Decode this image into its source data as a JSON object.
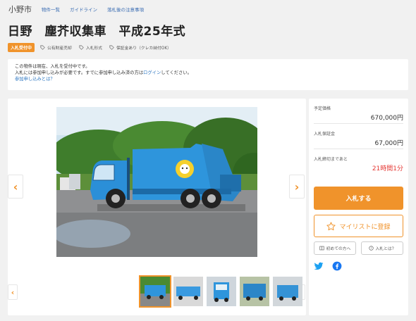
{
  "nav": {
    "brand": "小野市",
    "links": [
      "物件一覧",
      "ガイドライン",
      "落札後の注意事項"
    ]
  },
  "listing": {
    "title": "日野　塵芥収集車　平成25年式",
    "status_badge": "入札受付中",
    "tags": [
      {
        "icon": "tag-icon",
        "label": "公有財産売却"
      },
      {
        "icon": "tag-icon",
        "label": "入札形式"
      },
      {
        "icon": "tag-icon",
        "label": "保証金あり（クレカ納付OK）"
      }
    ]
  },
  "notice": {
    "line1": "この物件は現在、入札を受付中です。",
    "line2_before": "入札には参加申し込みが必要です。すでに参加申し込み済の方は",
    "line2_link": "ログイン",
    "line2_after": "してください。",
    "help_link": "参加申し込みとは？"
  },
  "gallery": {
    "prev_icon": "chevron-left-icon",
    "next_icon": "chevron-right-icon",
    "thumb_count": 5,
    "active_thumb": 0
  },
  "sidebar": {
    "expected_price_label": "予定価格",
    "expected_price_value": "670,000円",
    "deposit_label": "入札保証金",
    "deposit_value": "67,000円",
    "deadline_label": "入札締切まであと",
    "deadline_value": "21時間1分",
    "bid_button": "入札する",
    "mylist_button": "マイリストに登録",
    "beginner_button": "初めての方へ",
    "about_bid_button": "入札とは？"
  },
  "colors": {
    "accent": "#f0932b",
    "link": "#2b75c0",
    "deadline": "#e53935",
    "twitter": "#1da1f2",
    "facebook": "#1877f2"
  }
}
